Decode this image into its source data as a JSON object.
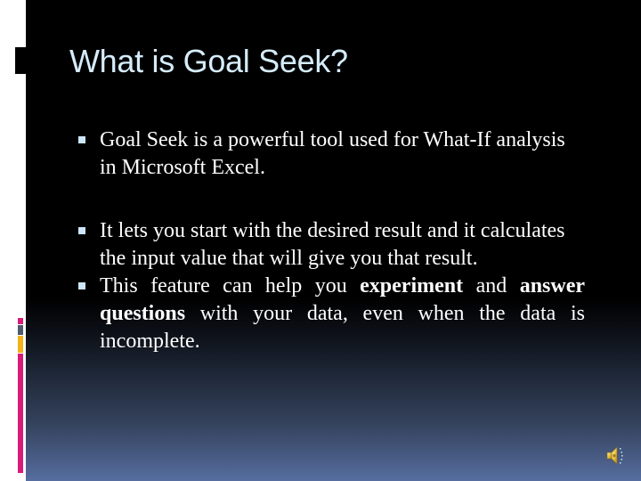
{
  "slide": {
    "title": "What is Goal Seek?",
    "bullets": [
      {
        "text": "Goal Seek is a powerful tool used for What-If analysis in Microsoft Excel."
      },
      {
        "text": "It lets you start with the desired result and it calculates the input value that will give you that result."
      },
      {
        "segments": [
          {
            "text": "This  feature  can  help you  ",
            "bold": false
          },
          {
            "text": "experiment",
            "bold": true
          },
          {
            "text": "  and  ",
            "bold": false
          },
          {
            "text": "answer  questions",
            "bold": true
          },
          {
            "text": "  with  your  data,  even when  the  data  is  incomplete.",
            "bold": false
          }
        ]
      }
    ],
    "audio_icon": "speaker-icon"
  },
  "colors": {
    "title": "#d5ecfa",
    "body_text": "#ffffff",
    "bullet": "#cde6fb",
    "accent_pink": "#d81b78",
    "accent_slate": "#4e5a6c",
    "accent_gold": "#f3b21a",
    "background_top": "#000000",
    "background_bottom": "#566fa0"
  }
}
